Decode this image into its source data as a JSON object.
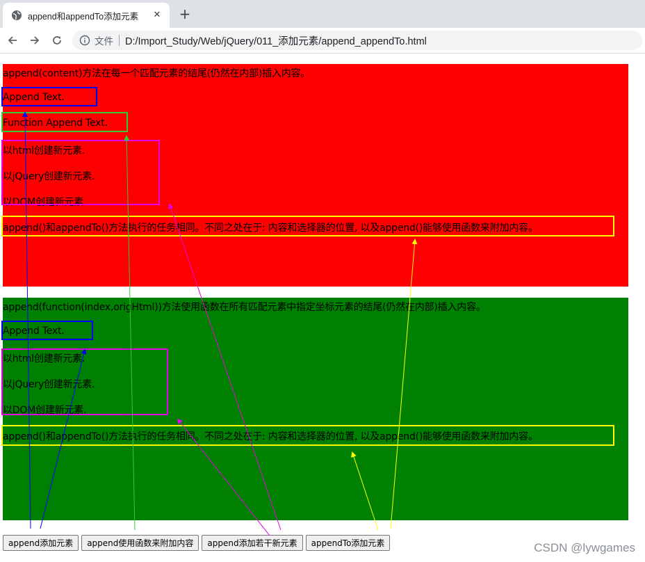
{
  "browser": {
    "tab_title": "append和appendTo添加元素",
    "tab_close": "✕",
    "new_tab": "+",
    "address_prefix": "文件",
    "address_url": "D:/Import_Study/Web/jQuery/011_添加元素/append_appendTo.html"
  },
  "red_box": {
    "color": "#ff0000",
    "lines": [
      "append(content)方法在每一个匹配元素的结尾(仍然在内部)插入内容。",
      "Append Text.",
      "Function Append Text.",
      "以html创建新元素.",
      "以jQuery创建新元素.",
      "以DOM创建新元素.",
      "append()和appendTo()方法执行的任务相同。不同之处在于: 内容和选择器的位置, 以及append()能够使用函数来附加内容。"
    ]
  },
  "green_box": {
    "color": "#008000",
    "lines": [
      "append(function(index,origHtml))方法使用函数在所有匹配元素中指定坐标元素的结尾(仍然在内部)插入内容。",
      "Append Text.",
      "以html创建新元素.",
      "以jQuery创建新元素.",
      "以DOM创建新元素.",
      "append()和appendTo()方法执行的任务相同。不同之处在于: 内容和选择器的位置, 以及append()能够使用函数来附加内容。"
    ]
  },
  "buttons": [
    "append添加元素",
    "append使用函数来附加内容",
    "append添加若干新元素",
    "appendTo添加元素"
  ],
  "annotation_colors": {
    "blue": "#0000ff",
    "green": "#33cc33",
    "magenta": "#e600e6",
    "yellow": "#ffff00"
  },
  "watermark": "CSDN @lywgames"
}
